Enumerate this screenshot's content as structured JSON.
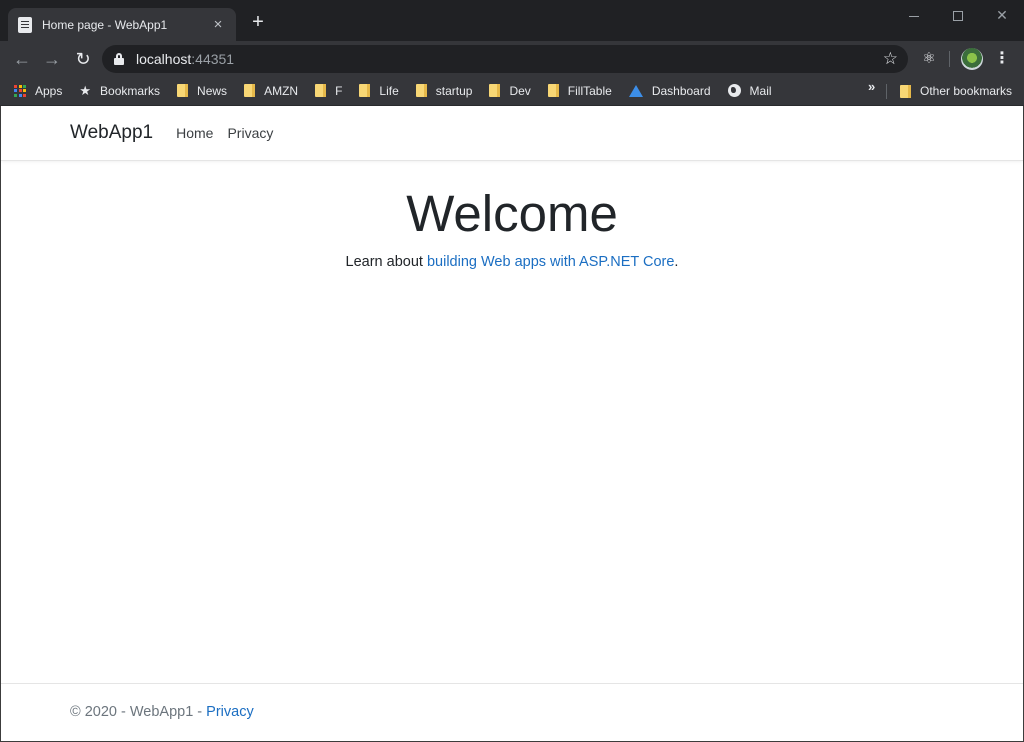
{
  "browser": {
    "tab": {
      "title": "Home page - WebApp1",
      "close": "×"
    },
    "new_tab": "+",
    "address": {
      "host": "localhost",
      "port": ":44351"
    },
    "bookmarks": [
      {
        "label": "Apps",
        "icon": "apps-icon"
      },
      {
        "label": "Bookmarks",
        "icon": "star-icon"
      },
      {
        "label": "News",
        "icon": "folder-icon"
      },
      {
        "label": "AMZN",
        "icon": "folder-icon"
      },
      {
        "label": "F",
        "icon": "folder-icon"
      },
      {
        "label": "Life",
        "icon": "folder-icon"
      },
      {
        "label": "startup",
        "icon": "folder-icon"
      },
      {
        "label": "Dev",
        "icon": "folder-icon"
      },
      {
        "label": "FillTable",
        "icon": "folder-icon"
      },
      {
        "label": "Dashboard",
        "icon": "azure-icon"
      },
      {
        "label": "Mail",
        "icon": "globe-icon"
      }
    ],
    "other_bookmarks": "Other bookmarks",
    "overflow": "»"
  },
  "site": {
    "brand": "WebApp1",
    "nav": [
      {
        "label": "Home"
      },
      {
        "label": "Privacy"
      }
    ],
    "main": {
      "title": "Welcome",
      "lead_prefix": "Learn about ",
      "lead_link": "building Web apps with ASP.NET Core",
      "lead_suffix": "."
    },
    "footer": {
      "text": "© 2020 - WebApp1 - ",
      "link": "Privacy"
    }
  },
  "colors": {
    "link": "#1b6ec2",
    "chrome_dark": "#202124",
    "chrome_toolbar": "#35363a"
  }
}
